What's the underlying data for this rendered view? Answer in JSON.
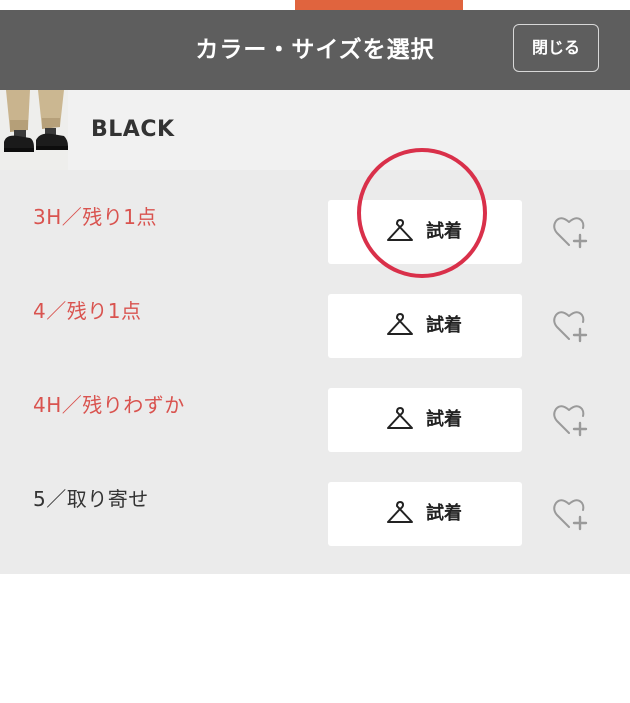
{
  "header": {
    "title": "カラー・サイズを選択",
    "close_label": "閉じる",
    "accent_color": "#e0643e",
    "background_color": "#5e5e5e"
  },
  "color_option": {
    "name": "BLACK",
    "thumbnail_icon": "product-photo-trousers-shoes"
  },
  "sizes": [
    {
      "label": "3H／残り1点",
      "status_color": "#d9534f",
      "try_label": "試着",
      "try_icon": "hanger-icon",
      "favorite_icon": "heart-plus-icon"
    },
    {
      "label": "4／残り1点",
      "status_color": "#d9534f",
      "try_label": "試着",
      "try_icon": "hanger-icon",
      "favorite_icon": "heart-plus-icon"
    },
    {
      "label": "4H／残りわずか",
      "status_color": "#d9534f",
      "try_label": "試着",
      "try_icon": "hanger-icon",
      "favorite_icon": "heart-plus-icon"
    },
    {
      "label": "5／取り寄せ",
      "status_color": "#333333",
      "try_label": "試着",
      "try_icon": "hanger-icon",
      "favorite_icon": "heart-plus-icon"
    }
  ],
  "annotation": {
    "type": "circle-highlight",
    "color": "#d9304a"
  }
}
